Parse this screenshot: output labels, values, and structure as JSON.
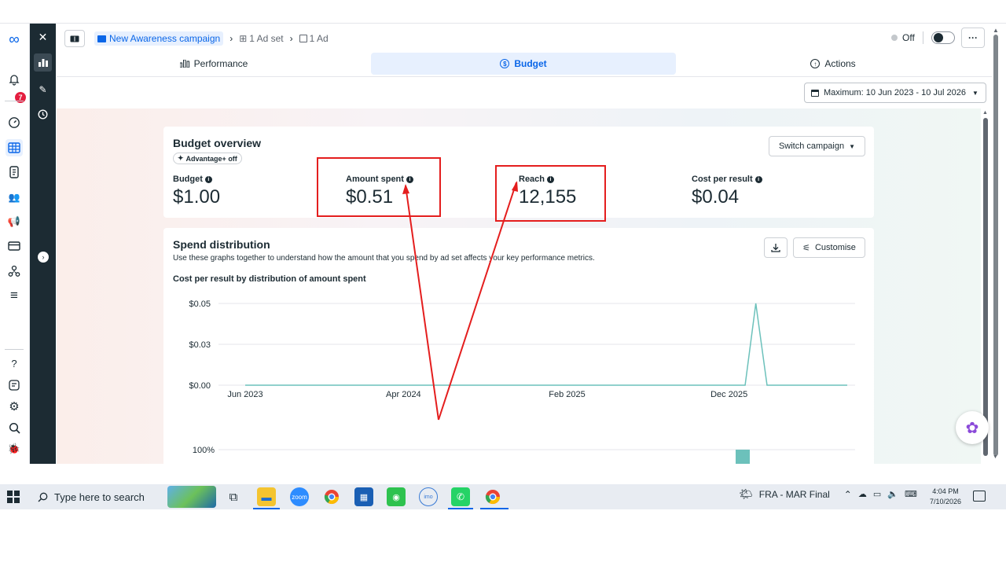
{
  "header": {
    "breadcrumb": {
      "campaign": "New Awareness campaign",
      "ad_set": "1 Ad set",
      "ad": "1 Ad"
    },
    "status_label": "Off",
    "more_label": "···",
    "date_range": "Maximum: 10 Jun 2023 - 10 Jul 2026"
  },
  "tabs": [
    {
      "label": "Performance",
      "icon": "bar-chart-icon"
    },
    {
      "label": "Budget",
      "icon": "dollar-circle-icon",
      "active": true
    },
    {
      "label": "Actions",
      "icon": "arrow-up-circle-icon"
    }
  ],
  "meta_rail": {
    "notification_count": "7",
    "icons": [
      "meta-logo-icon",
      "bell-icon",
      "dashboard-icon",
      "campaigns-grid-icon",
      "pages-icon",
      "audiences-icon",
      "ads-icon",
      "billing-icon",
      "business-icon",
      "menu-icon",
      "help-icon",
      "feedback-icon",
      "settings-icon",
      "search-icon",
      "bug-icon"
    ]
  },
  "budget_overview": {
    "title": "Budget overview",
    "advantage_tag": "Advantage+ off",
    "switch_button": "Switch campaign",
    "metrics": [
      {
        "label": "Budget",
        "value": "$1.00"
      },
      {
        "label": "Amount spent",
        "value": "$0.51"
      },
      {
        "label": "Reach",
        "value": "12,155"
      },
      {
        "label": "Cost per result",
        "value": "$0.04"
      }
    ]
  },
  "spend_distribution": {
    "title": "Spend distribution",
    "description": "Use these graphs together to understand how the amount that you spend by ad set affects your key performance metrics.",
    "chart_title": "Cost per result by distribution of amount spent",
    "customise_label": "Customise",
    "second_chart_top_label": "100%"
  },
  "chart_data": {
    "type": "line",
    "title": "Cost per result by distribution of amount spent",
    "y_ticks": [
      "$0.05",
      "$0.03",
      "$0.00"
    ],
    "x_ticks": [
      "Jun 2023",
      "Apr 2024",
      "Feb 2025",
      "Dec 2025"
    ],
    "ylim": [
      0,
      0.05
    ],
    "series": [
      {
        "color": "#6cc1bb",
        "x": [
          "2023-06-10",
          "2025-12-31",
          "2026-01-20",
          "2026-02-10",
          "2026-07-10"
        ],
        "values": [
          0,
          0,
          0.05,
          0,
          0
        ]
      }
    ],
    "grid": true
  },
  "taskbar": {
    "search_placeholder": "Type here to search",
    "tray_label": "FRA - MAR Final",
    "time": "4:04 PM",
    "date": "7/10/2026"
  },
  "colors": {
    "accent": "#0a66e8",
    "annotation": "#e41e1e",
    "line": "#6cc1bb"
  }
}
